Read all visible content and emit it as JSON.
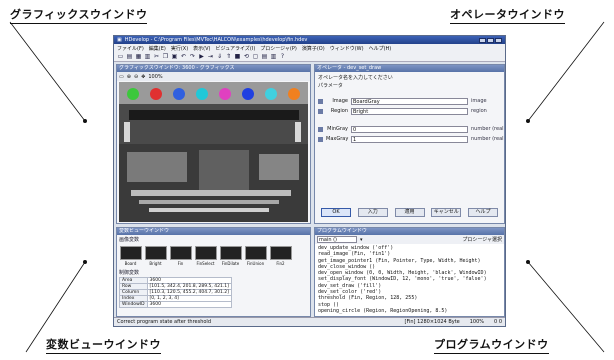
{
  "callouts": {
    "graphics": "グラフィックスウインドウ",
    "operator": "オペレータウインドウ",
    "variable": "変数ビューウインドウ",
    "program": "プログラムウインドウ"
  },
  "window": {
    "title": "HDevelop - C:\\Program Files\\MVTec\\HALCON\\examples\\hdevelop\\fin.hdev",
    "menu": [
      "ファイル(F)",
      "編集(E)",
      "実行(X)",
      "表示(V)",
      "ビジュアライズ(I)",
      "プロシージャ(P)",
      "演算子(O)",
      "ウィンドウ(W)",
      "ヘルプ(H)"
    ]
  },
  "graphics_window": {
    "title": "グラフィックスウインドウ: 3600 - グラフィックス",
    "zoom_label": "100%",
    "spot_colors": [
      "#3cc83c",
      "#e03030",
      "#3060e0",
      "#20c8d8",
      "#e040c0",
      "#2040e0",
      "#40d0e0",
      "#f08020"
    ]
  },
  "operator_window": {
    "title": "オペレータ - dev_set_draw",
    "subtitle": "オペレータ名を入力してください",
    "section": "パラメータ",
    "rows": [
      {
        "label": "Image",
        "value": "BoardGray",
        "unit": "image"
      },
      {
        "label": "Region",
        "value": "Bright",
        "unit": "region"
      },
      {
        "label": "MinGray",
        "value": "0",
        "unit": "number (real)"
      },
      {
        "label": "MaxGray",
        "value": "1",
        "unit": "number (real)"
      }
    ],
    "buttons": [
      "OK",
      "入力",
      "適用",
      "キャンセル",
      "ヘルプ"
    ]
  },
  "variable_window": {
    "title": "変数ビューウインドウ",
    "iconic_title": "画像変数",
    "thumbs": [
      "Board",
      "Bright",
      "Fin",
      "FinSelect",
      "FinDilate",
      "FinUnion",
      "Fin2"
    ],
    "control_title": "制御変数",
    "control_vars": [
      {
        "name": "Area",
        "value": "3600"
      },
      {
        "name": "Row",
        "value": "[101.5, 342.4, 201.8, 289.5, 421.1]"
      },
      {
        "name": "Column",
        "value": "[110.3, 120.5, 455.2, 404.7, 301.2]"
      },
      {
        "name": "Index",
        "value": "[0, 1, 2, 3, 4]"
      },
      {
        "name": "WindowID",
        "value": "3600"
      }
    ]
  },
  "program_window": {
    "title": "プログラムウインドウ",
    "procedure": "main ()",
    "right_label": "プロシージャ選択",
    "lines": [
      "dev_update_window ('off')",
      "read_image (Fin, 'fin1')",
      "get_image_pointer1 (Fin, Pointer, Type, Width, Height)",
      "dev_close_window ()",
      "dev_open_window (0, 0, Width, Height, 'black', WindowID)",
      "set_display_font (WindowID, 12, 'mono', 'true', 'false')",
      "dev_set_draw ('fill')",
      "dev_set_color ('red')",
      "threshold (Fin, Region, 128, 255)",
      "stop ()",
      "opening_circle (Region, RegionOpening, 8.5)"
    ]
  },
  "statusbar": {
    "left": "Correct program state after threshold",
    "center": "[Fin] 1280×1024 Byte",
    "zoom": "100%",
    "coords": "0 0"
  }
}
